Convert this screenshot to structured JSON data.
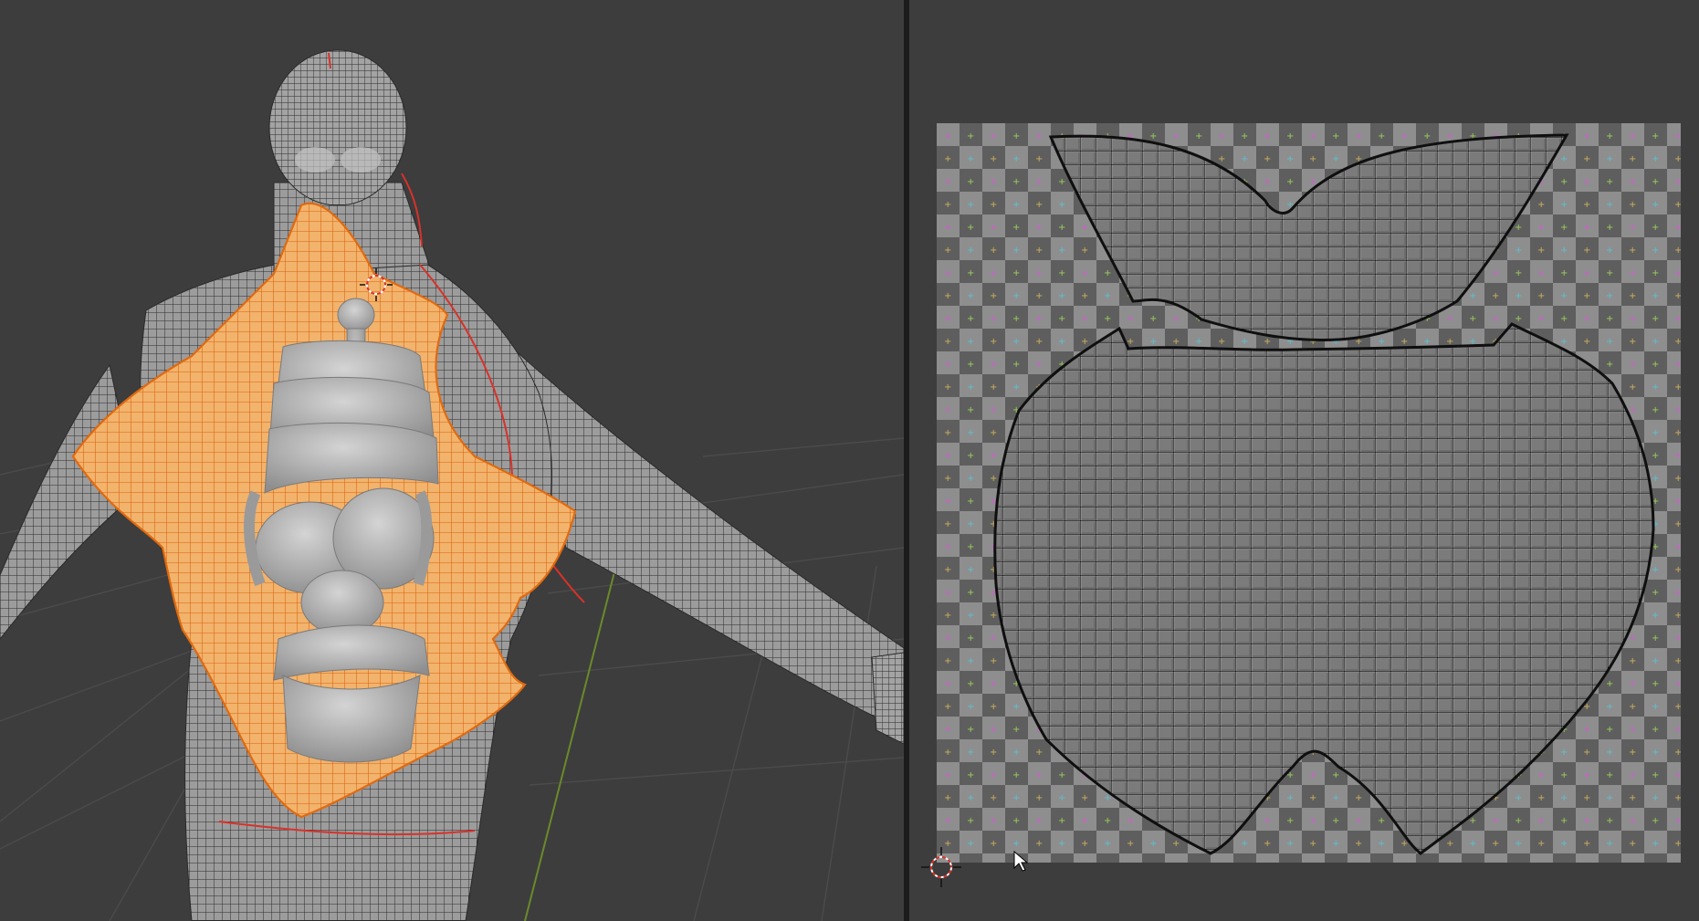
{
  "colors": {
    "viewport_background": "#3d3d3d",
    "grid_line": "#4a4a4a",
    "y_axis": "#6b8a2a",
    "mesh_surface": "#9a9a9a",
    "mesh_wire": "#2a2a2a",
    "selection_face": "#f0b26a",
    "selection_edge": "#e06a10",
    "seam_edge": "#d8322a",
    "organ_surface": "#b8b8b8",
    "checker_light": "#8d8d8d",
    "checker_dark": "#5e5e5e",
    "uv_wire": "#141414",
    "uv_fill": "#666666",
    "divider": "#1b1b1b"
  },
  "icons": {
    "cursor_3d": "3d-cursor-icon",
    "cursor_2d": "2d-cursor-icon",
    "mouse_pointer": "mouse-pointer-icon"
  }
}
